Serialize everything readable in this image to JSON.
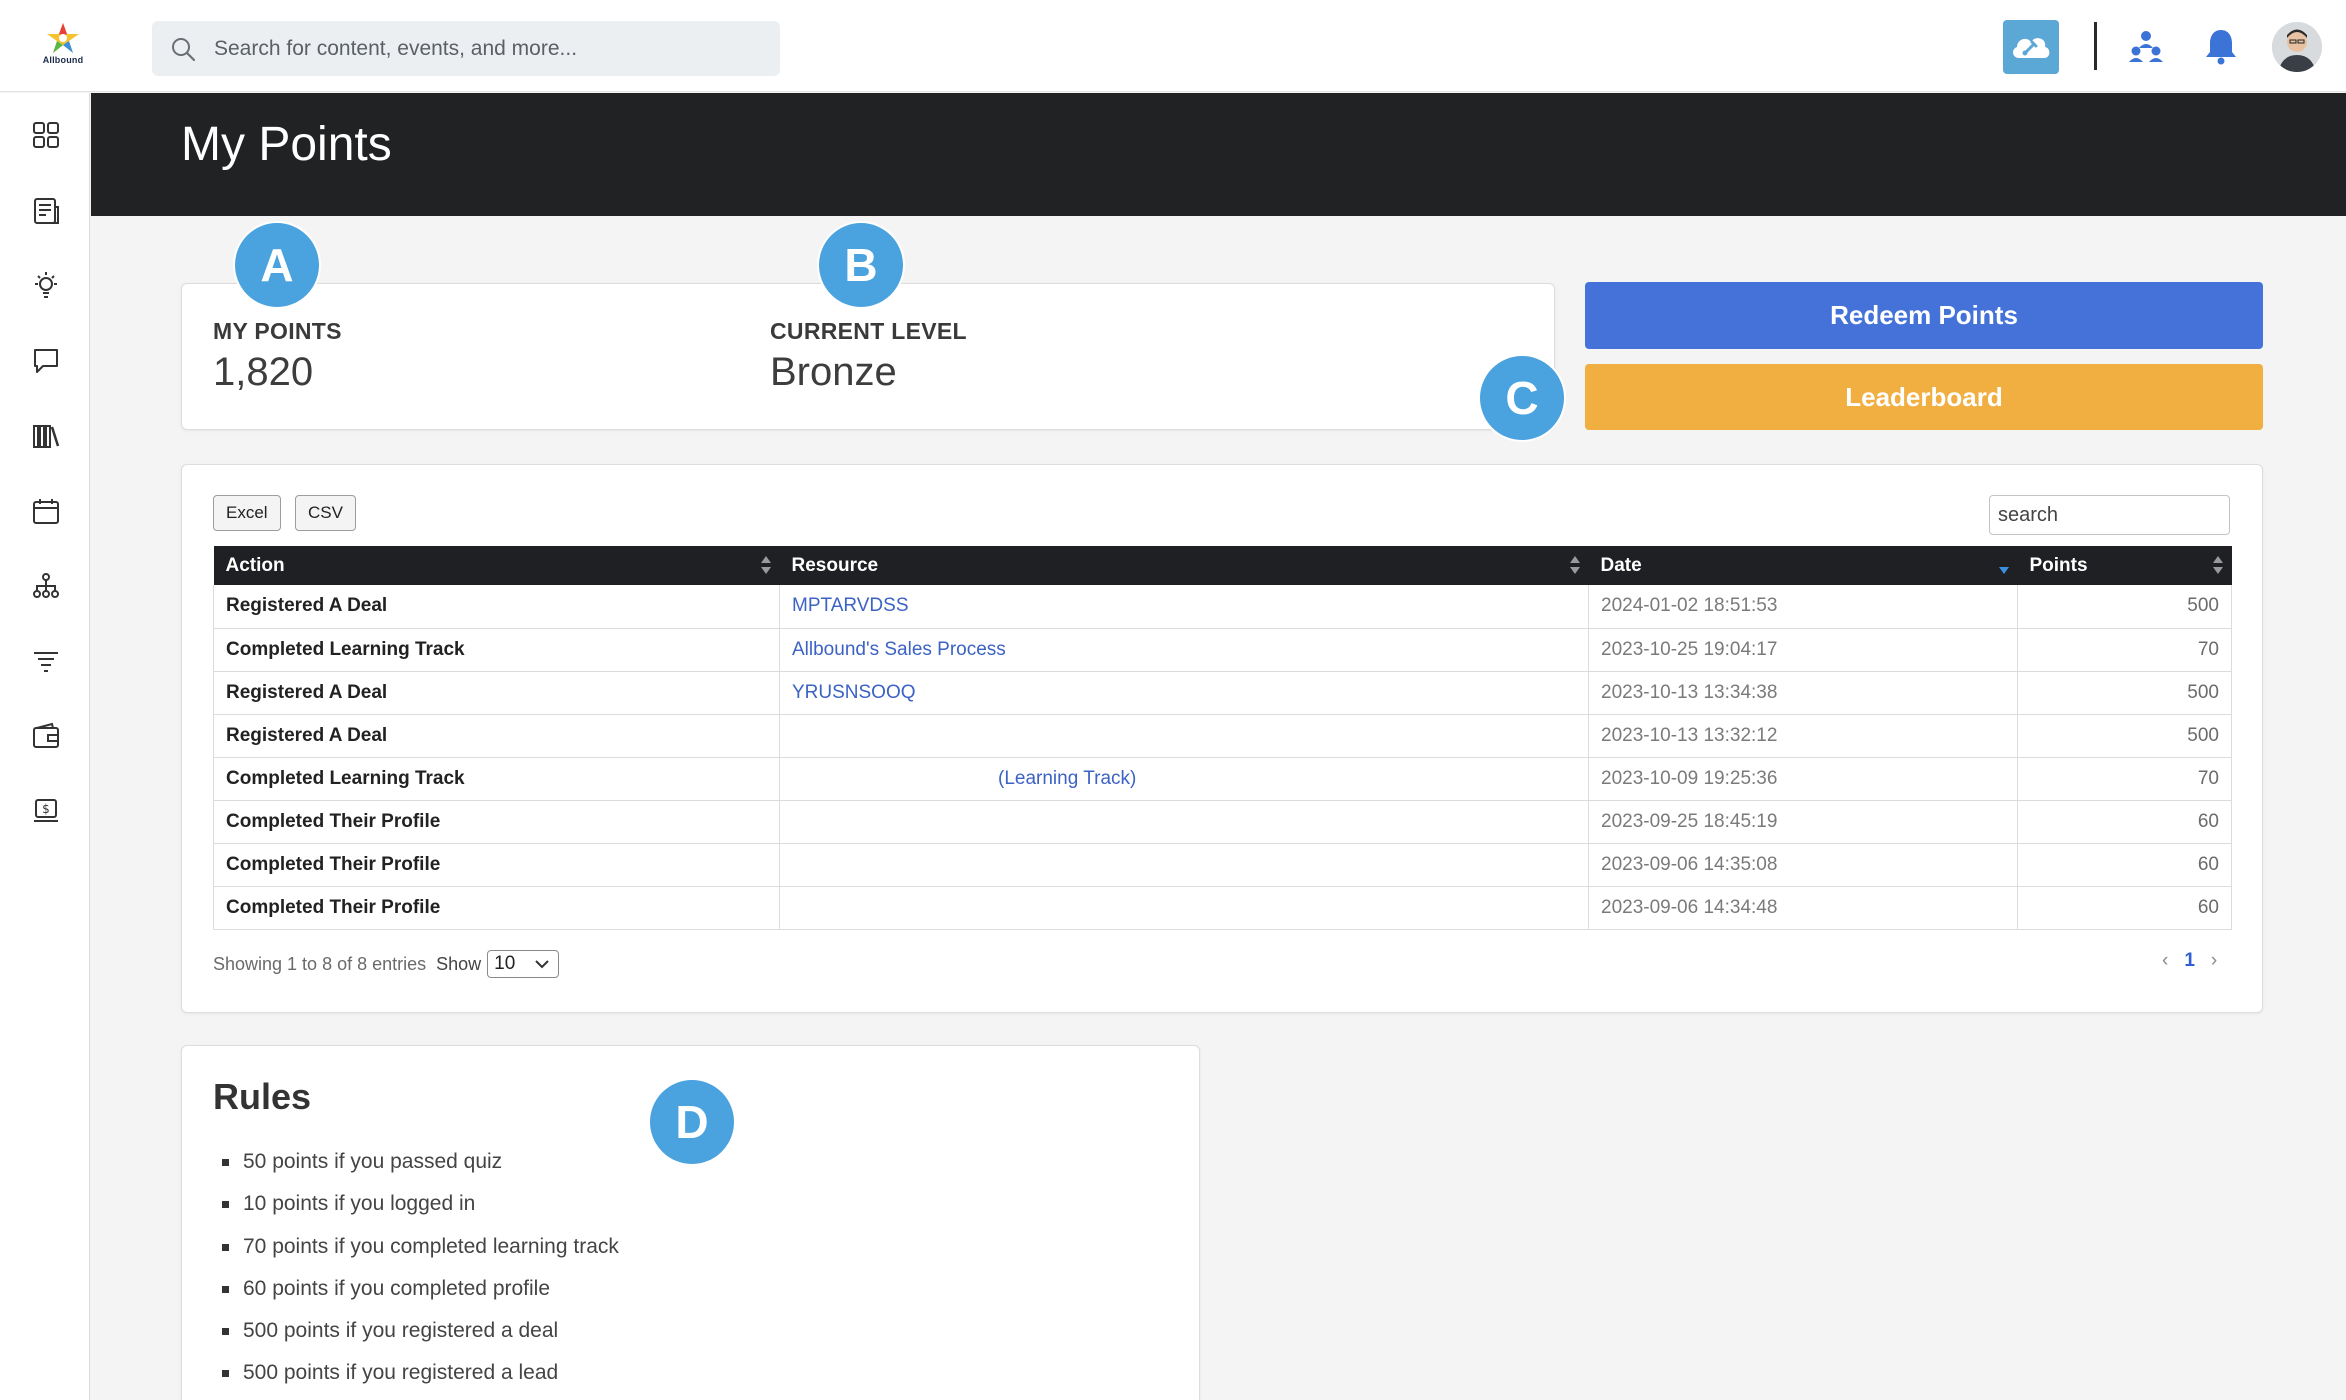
{
  "app": {
    "logo_text": "Allbound"
  },
  "topbar": {
    "search_placeholder": "Search for content, events, and more..."
  },
  "header": {
    "title": "My Points"
  },
  "stats": {
    "points_label": "MY POINTS",
    "points_value": "1,820",
    "level_label": "CURRENT LEVEL",
    "level_value": "Bronze"
  },
  "actions": {
    "redeem_label": "Redeem Points",
    "leaderboard_label": "Leaderboard"
  },
  "table": {
    "export_excel": "Excel",
    "export_csv": "CSV",
    "search_placeholder": "search",
    "columns": [
      "Action",
      "Resource",
      "Date",
      "Points"
    ],
    "rows": [
      {
        "action": "Registered A Deal",
        "resource": "MPTARVDSS",
        "date": "2024-01-02 18:51:53",
        "points": "500"
      },
      {
        "action": "Completed Learning Track",
        "resource": "Allbound's Sales Process",
        "date": "2023-10-25 19:04:17",
        "points": "70"
      },
      {
        "action": "Registered A Deal",
        "resource": "YRUSNSOOQ",
        "date": "2023-10-13 13:34:38",
        "points": "500"
      },
      {
        "action": "Registered A Deal",
        "resource": "",
        "date": "2023-10-13 13:32:12",
        "points": "500"
      },
      {
        "action": "Completed Learning Track",
        "resource": "(Learning Track)",
        "date": "2023-10-09 19:25:36",
        "points": "70"
      },
      {
        "action": "Completed Their Profile",
        "resource": "",
        "date": "2023-09-25 18:45:19",
        "points": "60"
      },
      {
        "action": "Completed Their Profile",
        "resource": "",
        "date": "2023-09-06 14:35:08",
        "points": "60"
      },
      {
        "action": "Completed Their Profile",
        "resource": "",
        "date": "2023-09-06 14:34:48",
        "points": "60"
      }
    ],
    "info": "Showing 1 to 8 of 8 entries",
    "show_label": "Show",
    "page_size": "10",
    "prev": "‹",
    "current_page": "1",
    "next": "›"
  },
  "rules": {
    "title": "Rules",
    "items": [
      "50 points if you passed quiz",
      "10 points if you logged in",
      "70 points if you completed learning track",
      "60 points if you completed profile",
      "500 points if you registered a deal",
      "500 points if you registered a lead"
    ]
  },
  "markers": [
    "A",
    "B",
    "C",
    "D"
  ],
  "colors": {
    "primary_blue": "#4472d9",
    "leaderboard_orange": "#f1ae41",
    "header_dark": "#202224",
    "marker_blue": "#4aa3df",
    "link_blue": "#3b62c4"
  },
  "icons": {
    "sidebar": [
      "dashboard-icon",
      "news-icon",
      "lightbulb-icon",
      "chat-icon",
      "library-icon",
      "calendar-icon",
      "org-chart-icon",
      "filter-icon",
      "wallet-icon",
      "billing-icon"
    ],
    "topbar": [
      "search-icon",
      "cloud-tool-icon",
      "team-icon",
      "bell-icon"
    ]
  }
}
